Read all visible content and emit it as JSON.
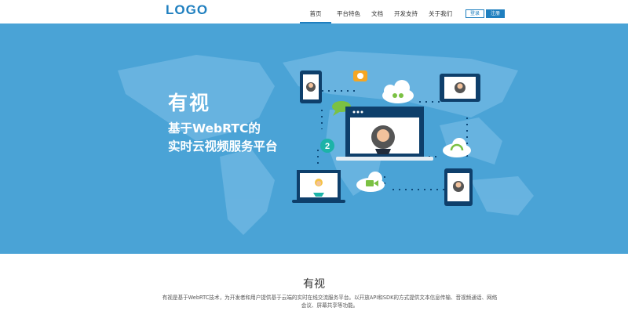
{
  "header": {
    "logo": "LOGO",
    "nav": [
      "首页",
      "平台特色",
      "文档",
      "开发支持",
      "关于我们"
    ],
    "login_label": "登录",
    "register_label": "注册"
  },
  "banner": {
    "title": "有视",
    "subtitle_line1": "基于WebRTC的",
    "subtitle_line2": "实时云视频服务平台",
    "step_badge": "2"
  },
  "intro": {
    "title": "有视",
    "text": "有视是基于WebRTC技术，为开发者和用户提供基于云端的实时在线交流服务平台。以开放API和SDK的方式提供文本信息传输、音视频通话、网络会议、屏幕共享等功能。"
  },
  "colors": {
    "brand": "#1f7fbf",
    "banner_bg": "#4aa3d6",
    "map": "#6db6e2"
  }
}
